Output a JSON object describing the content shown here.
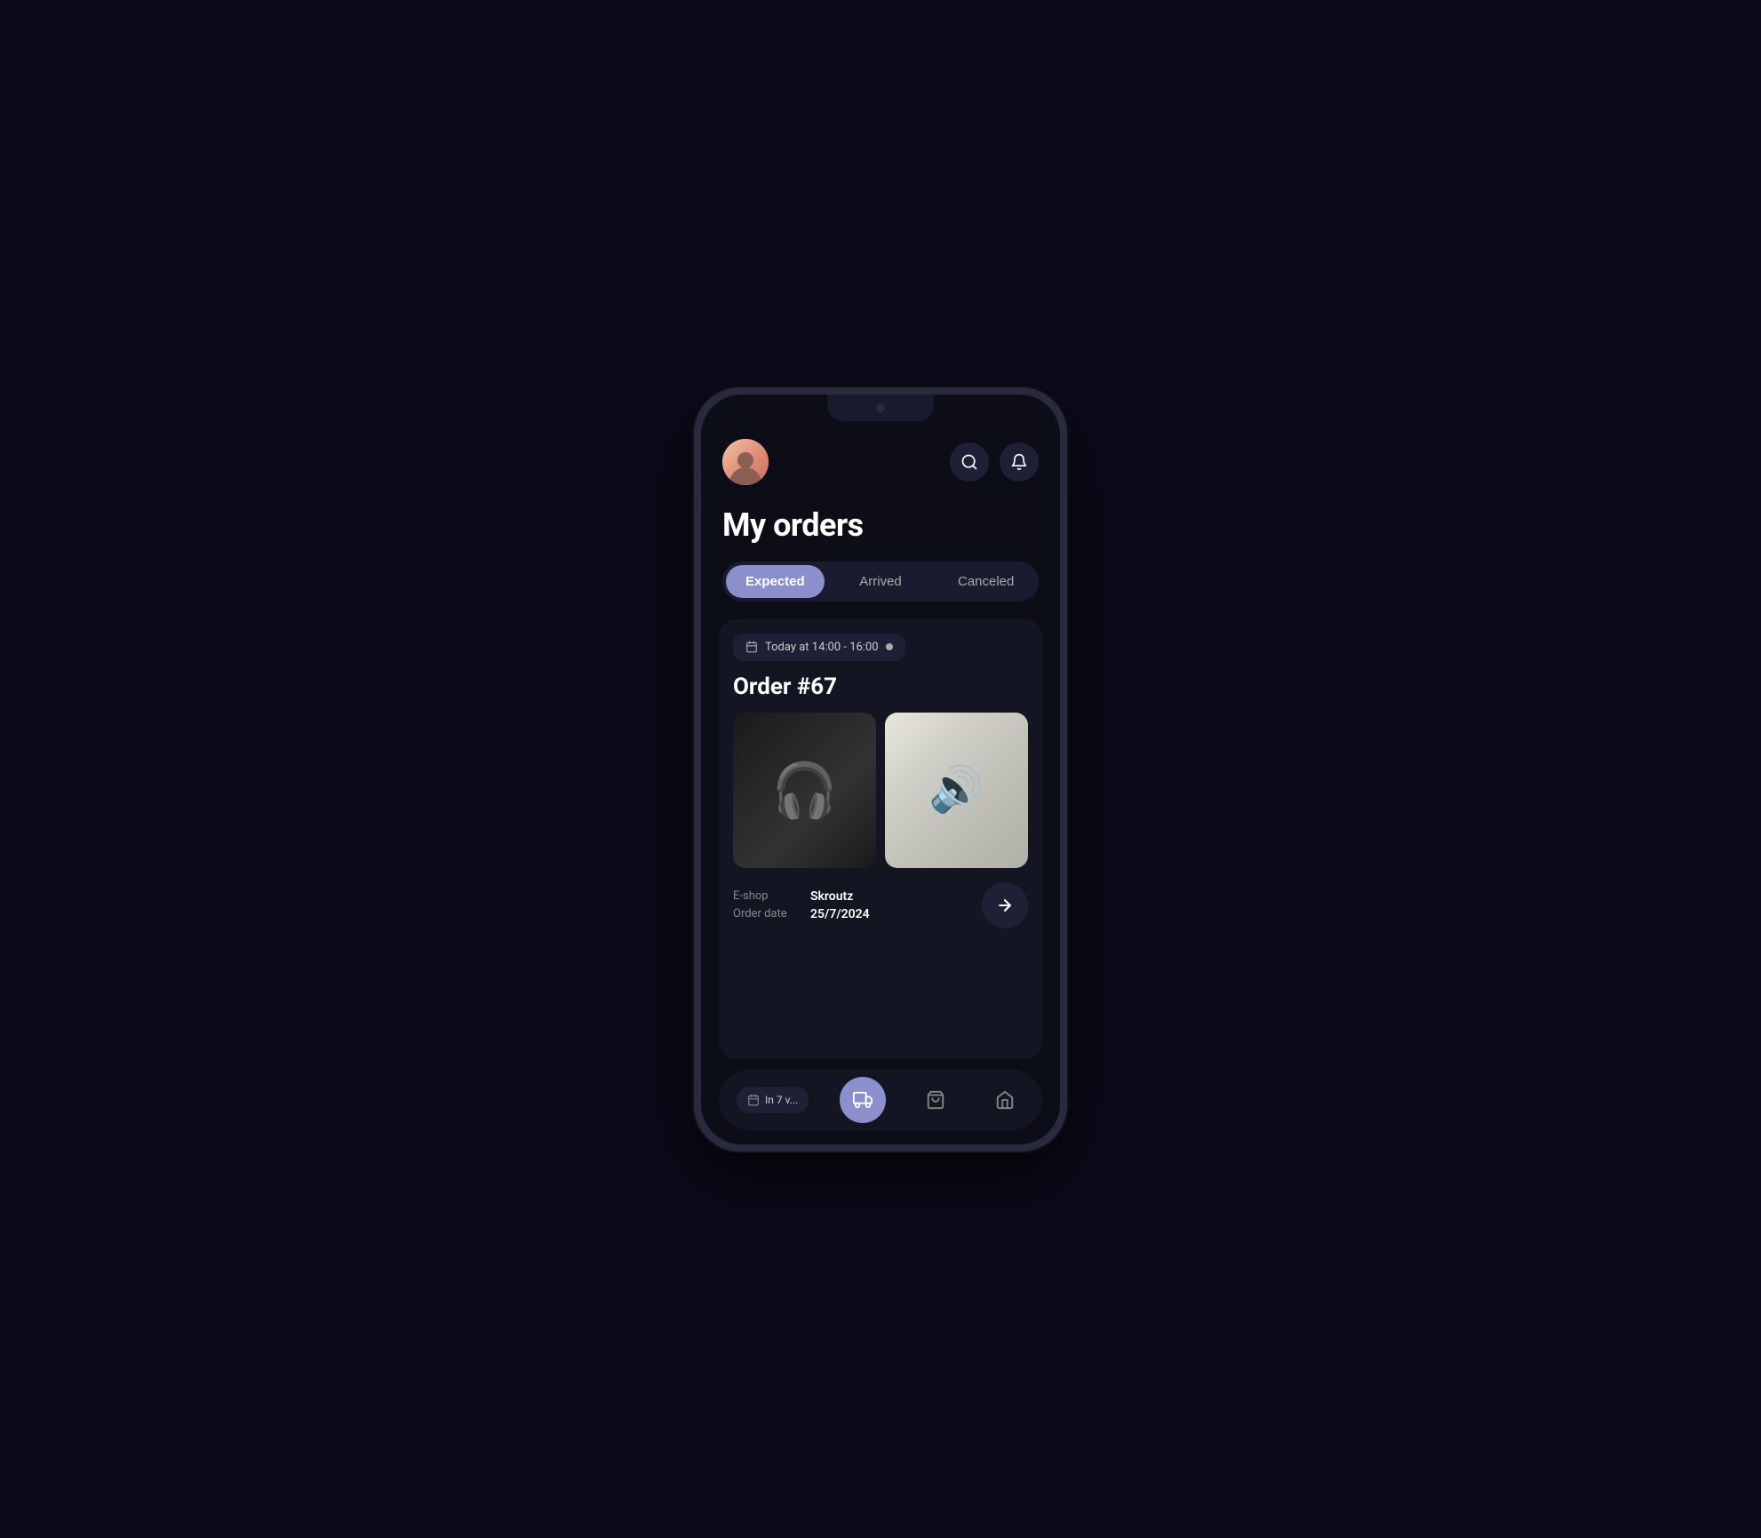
{
  "page": {
    "title": "My orders",
    "bg_color": "#0d0a1a"
  },
  "header": {
    "search_label": "Search",
    "notification_label": "Notifications"
  },
  "tabs": {
    "items": [
      {
        "id": "expected",
        "label": "Expected",
        "active": true
      },
      {
        "id": "arrived",
        "label": "Arrived",
        "active": false
      },
      {
        "id": "canceled",
        "label": "Canceled",
        "active": false
      }
    ]
  },
  "order": {
    "delivery_time": "Today at 14:00 - 16:00",
    "order_number": "Order #67",
    "eshop_label": "E-shop",
    "eshop_value": "Skroutz",
    "order_date_label": "Order date",
    "order_date_value": "25/7/2024",
    "product_1_alt": "Marshall headphones",
    "product_2_alt": "Mini guitar amplifier"
  },
  "bottom_nav": {
    "delivery_info": "In 7 v...",
    "truck_label": "Orders",
    "bag_label": "Shopping",
    "store_label": "Store"
  }
}
